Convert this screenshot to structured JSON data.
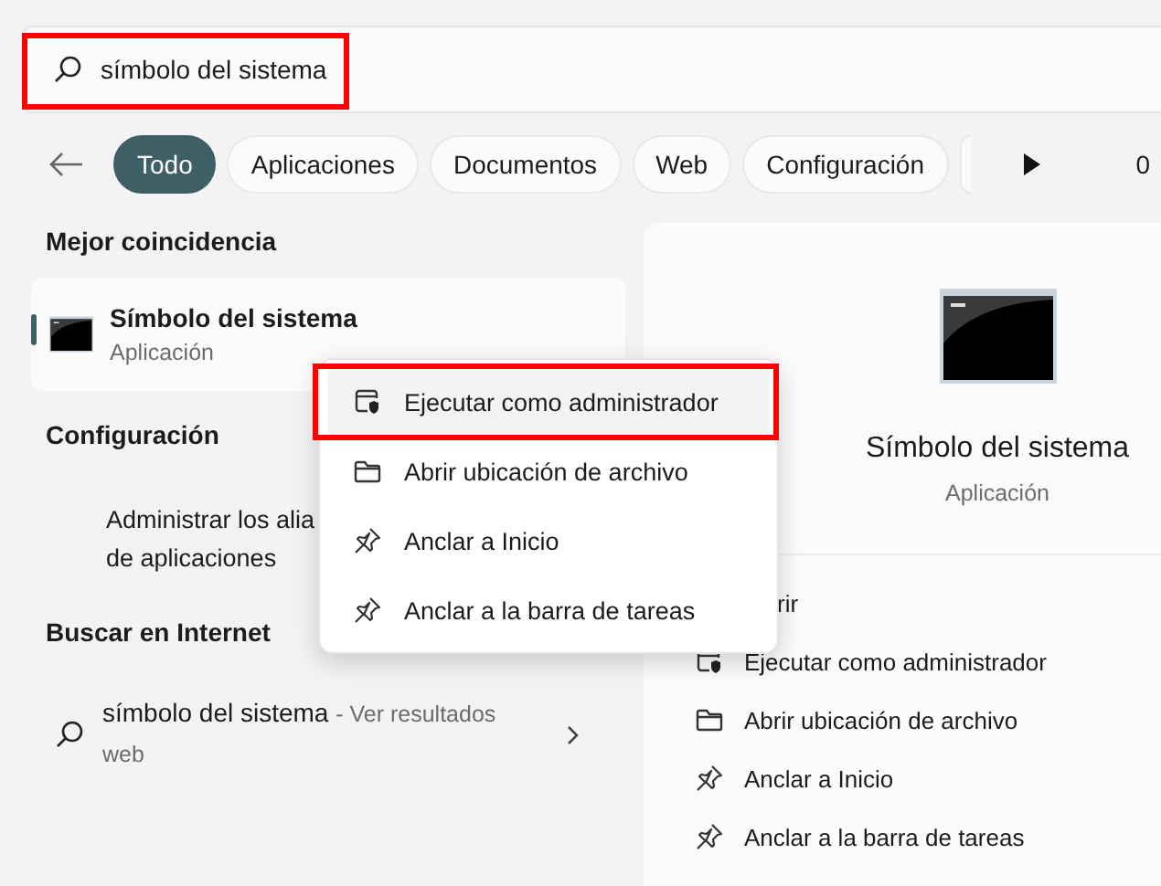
{
  "search": {
    "value": "símbolo del sistema"
  },
  "filters": [
    {
      "label": "Todo",
      "selected": true
    },
    {
      "label": "Aplicaciones",
      "selected": false
    },
    {
      "label": "Documentos",
      "selected": false
    },
    {
      "label": "Web",
      "selected": false
    },
    {
      "label": "Configuración",
      "selected": false
    }
  ],
  "filter_overflow_text": "0",
  "best_match": {
    "heading": "Mejor coincidencia",
    "title": "Símbolo del sistema",
    "subtitle": "Aplicación",
    "selected": true
  },
  "settings": {
    "heading": "Configuración",
    "item_lines": [
      "Administrar los alia",
      "de aplicaciones"
    ]
  },
  "web_search": {
    "heading": "Buscar en Internet",
    "query": "símbolo del sistema",
    "suffix": "- Ver resultados web"
  },
  "context_menu": [
    {
      "kind": "admin",
      "label": "Ejecutar como administrador",
      "selected": true
    },
    {
      "kind": "folder",
      "label": "Abrir ubicación de archivo",
      "selected": false
    },
    {
      "kind": "pin",
      "label": "Anclar a Inicio",
      "selected": false
    },
    {
      "kind": "pin",
      "label": "Anclar a la barra de tareas",
      "selected": false
    }
  ],
  "detail": {
    "title": "Símbolo del sistema",
    "subtitle": "Aplicación",
    "actions": [
      {
        "kind": "covered",
        "label": "rir"
      },
      {
        "kind": "admin",
        "label": "Ejecutar como administrador"
      },
      {
        "kind": "folder",
        "label": "Abrir ubicación de archivo"
      },
      {
        "kind": "pin",
        "label": "Anclar a Inicio"
      },
      {
        "kind": "pin",
        "label": "Anclar a la barra de tareas"
      }
    ]
  }
}
